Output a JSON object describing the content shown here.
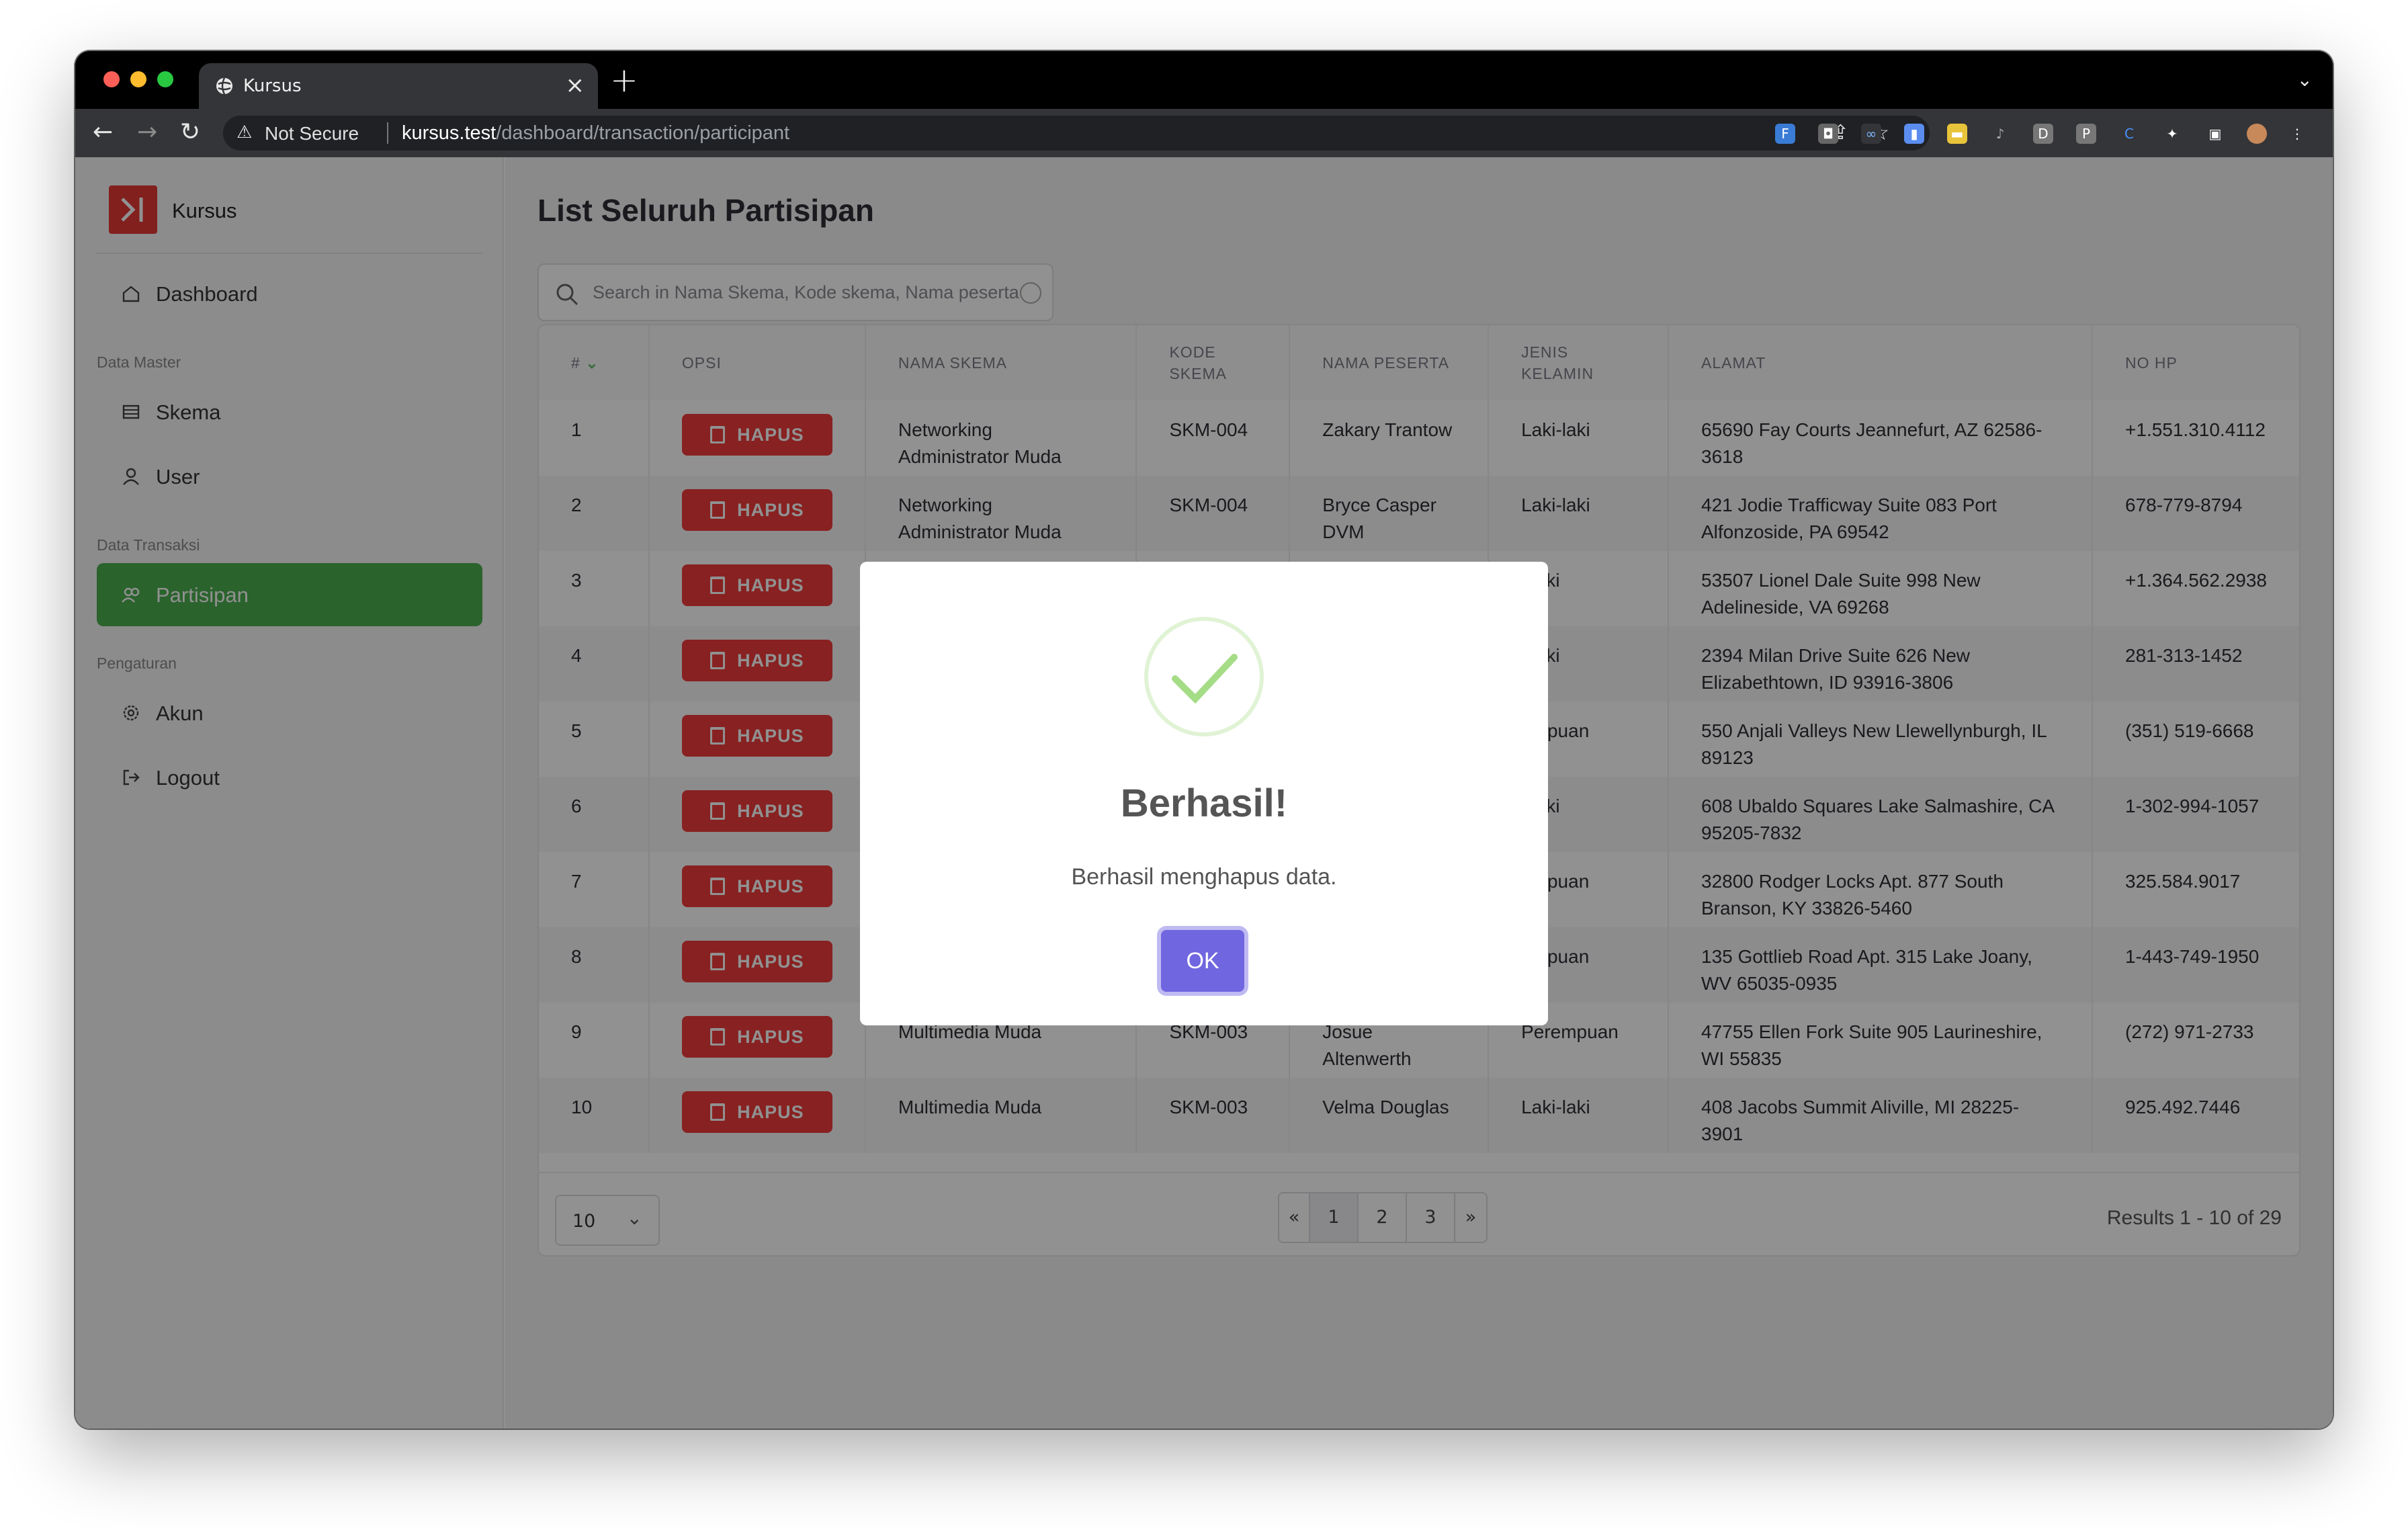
{
  "browser": {
    "tab_title": "Kursus",
    "new_tab_label": "+",
    "url_warning": "Not Secure",
    "url_host": "kursus.test",
    "url_path": "/dashboard/transaction/participant"
  },
  "sidebar": {
    "brand": "Kursus",
    "items": [
      {
        "label": "Dashboard",
        "icon": "home-icon"
      },
      {
        "label": "Skema",
        "icon": "table-icon"
      },
      {
        "label": "User",
        "icon": "user-icon"
      },
      {
        "label": "Partisipan",
        "icon": "users-icon"
      },
      {
        "label": "Akun",
        "icon": "gear-icon"
      },
      {
        "label": "Logout",
        "icon": "logout-icon"
      }
    ],
    "groups": [
      "Data Master",
      "Data Transaksi",
      "Pengaturan"
    ],
    "active_color": "#4caf50"
  },
  "main": {
    "title": "List Seluruh Partisipan",
    "search_placeholder": "Search in Nama Skema, Kode skema, Nama peserta",
    "columns": [
      "#",
      "OPSI",
      "NAMA SKEMA",
      "KODE SKEMA",
      "NAMA PESERTA",
      "JENIS KELAMIN",
      "ALAMAT",
      "NO HP"
    ],
    "delete_label": "HAPUS",
    "rows": [
      {
        "no": "1",
        "skema": "Networking Administrator Muda",
        "kode": "SKM-004",
        "nama": "Zakary Trantow",
        "jk": "Laki-laki",
        "alamat": "65690 Fay Courts Jeannefurt, AZ 62586-3618",
        "hp": "+1.551.310.4112"
      },
      {
        "no": "2",
        "skema": "Networking Administrator Muda",
        "kode": "SKM-004",
        "nama": "Bryce Casper DVM",
        "jk": "Laki-laki",
        "alamat": "421 Jodie Trafficway Suite 083 Port Alfonzoside, PA 69542",
        "hp": "678-779-8794"
      },
      {
        "no": "3",
        "skema": "",
        "kode": "",
        "nama": "",
        "jk": "i-laki",
        "alamat": "53507 Lionel Dale Suite 998 New Adelineside, VA 69268",
        "hp": "+1.364.562.2938"
      },
      {
        "no": "4",
        "skema": "",
        "kode": "",
        "nama": "",
        "jk": "i-laki",
        "alamat": "2394 Milan Drive Suite 626 New Elizabethtown, ID 93916-3806",
        "hp": "281-313-1452"
      },
      {
        "no": "5",
        "skema": "",
        "kode": "",
        "nama": "",
        "jk": "empuan",
        "alamat": "550 Anjali Valleys New Llewellynburgh, IL 89123",
        "hp": "(351) 519-6668"
      },
      {
        "no": "6",
        "skema": "",
        "kode": "",
        "nama": "",
        "jk": "i-laki",
        "alamat": "608 Ubaldo Squares Lake Salmashire, CA 95205-7832",
        "hp": "1-302-994-1057"
      },
      {
        "no": "7",
        "skema": "",
        "kode": "",
        "nama": "",
        "jk": "empuan",
        "alamat": "32800 Rodger Locks Apt. 877 South Branson, KY 33826-5460",
        "hp": "325.584.9017"
      },
      {
        "no": "8",
        "skema": "",
        "kode": "",
        "nama": "",
        "jk": "empuan",
        "alamat": "135 Gottlieb Road Apt. 315 Lake Joany, WV 65035-0935",
        "hp": "1-443-749-1950"
      },
      {
        "no": "9",
        "skema": "Multimedia Muda",
        "kode": "SKM-003",
        "nama": "Josue Altenwerth",
        "jk": "Perempuan",
        "alamat": "47755 Ellen Fork Suite 905 Laurineshire, WI 55835",
        "hp": "(272) 971-2733"
      },
      {
        "no": "10",
        "skema": "Multimedia Muda",
        "kode": "SKM-003",
        "nama": "Velma Douglas",
        "jk": "Laki-laki",
        "alamat": "408 Jacobs Summit Aliville, MI 28225-3901",
        "hp": "925.492.7446"
      }
    ],
    "per_page": "10",
    "pages": [
      "«",
      "1",
      "2",
      "3",
      "»"
    ],
    "current_page": "1",
    "results_text": "Results 1 - 10 of 29"
  },
  "modal": {
    "title": "Berhasil!",
    "message": "Berhasil menghapus data.",
    "ok_label": "OK",
    "accent": "#7066e0",
    "success_color": "#a5dc86"
  }
}
